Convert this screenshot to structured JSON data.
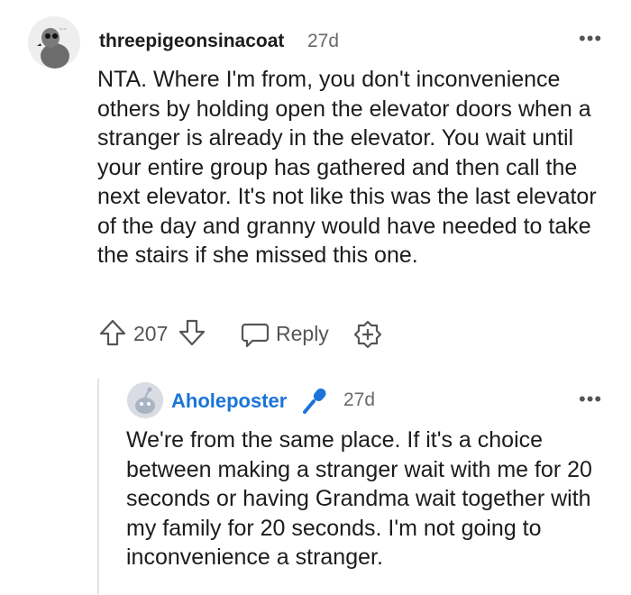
{
  "comment": {
    "username": "threepigeonsinacoat",
    "time": "27d",
    "more": "•••",
    "body": "NTA. Where I'm from, you don't inconvenience others by holding open the elevator doors when a stranger is already in the elevator. You wait until your entire group has gathered and then call the next elevator. It's not like this was the last elevator of the day and granny would have needed to take the stairs if she missed this one.",
    "votes": "207",
    "reply_label": "Reply"
  },
  "reply": {
    "username": "Aholeposter",
    "time": "27d",
    "more": "•••",
    "body": "We're from the same place. If it's a choice between making a stranger wait with me for 20 seconds or having Grandma wait together with my family for 20 seconds. I'm not going to inconvenience a stranger."
  },
  "colors": {
    "op_username": "#1a74d9",
    "text": "#1c1c1c",
    "meta": "#6a6a6a"
  },
  "icons": [
    "upvote-icon",
    "downvote-icon",
    "reply-icon",
    "award-icon",
    "more-icon",
    "microphone-icon"
  ]
}
